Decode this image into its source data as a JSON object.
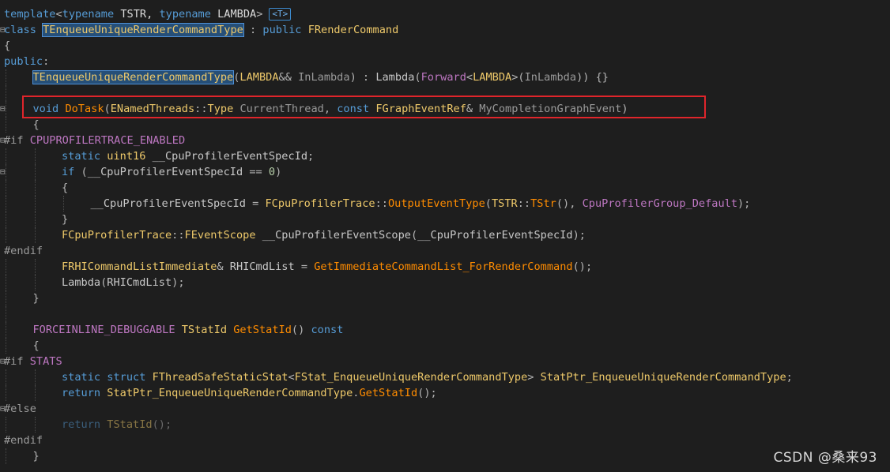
{
  "colors": {
    "background": "#1e1e1e",
    "keyword": "#569cd6",
    "type": "#4ec9b0",
    "function": "#ff8c00",
    "macro": "#be77c2",
    "highlight_box": "#e0252b"
  },
  "template_badge": "<T>",
  "watermark": "CSDN @桑来93",
  "lines": [
    {
      "indent": 0,
      "tokens": [
        {
          "t": "template",
          "c": "kw"
        },
        {
          "t": "<",
          "c": "punct"
        },
        {
          "t": "typename",
          "c": "kw"
        },
        {
          "t": " TSTR, ",
          "c": "plain"
        },
        {
          "t": "typename",
          "c": "kw"
        },
        {
          "t": " LAMBDA",
          "c": "plain"
        },
        {
          "t": ">",
          "c": "punct"
        }
      ],
      "badge": true
    },
    {
      "indent": 0,
      "fold": true,
      "tokens": [
        {
          "t": "class",
          "c": "kw"
        },
        {
          "t": " ",
          "c": "plain"
        },
        {
          "t": "TEnqueueUniqueRenderCommandType",
          "c": "ftype",
          "sel": true
        },
        {
          "t": " : ",
          "c": "punct"
        },
        {
          "t": "public",
          "c": "kw"
        },
        {
          "t": " ",
          "c": "plain"
        },
        {
          "t": "FRenderCommand",
          "c": "ftype"
        }
      ]
    },
    {
      "indent": 0,
      "tokens": [
        {
          "t": "{",
          "c": "punct"
        }
      ]
    },
    {
      "indent": 0,
      "tokens": [
        {
          "t": "public",
          "c": "kw"
        },
        {
          "t": ":",
          "c": "punct"
        }
      ]
    },
    {
      "indent": 1,
      "tokens": [
        {
          "t": "TEnqueueUniqueRenderCommandType",
          "c": "ftype",
          "sel": true
        },
        {
          "t": "(",
          "c": "punct"
        },
        {
          "t": "LAMBDA",
          "c": "ftype"
        },
        {
          "t": "&& ",
          "c": "punct"
        },
        {
          "t": "InLambda",
          "c": "param"
        },
        {
          "t": ") : ",
          "c": "punct"
        },
        {
          "t": "Lambda",
          "c": "var"
        },
        {
          "t": "(",
          "c": "punct"
        },
        {
          "t": "Forward",
          "c": "macro"
        },
        {
          "t": "<",
          "c": "punct"
        },
        {
          "t": "LAMBDA",
          "c": "ftype"
        },
        {
          "t": ">(",
          "c": "punct"
        },
        {
          "t": "InLambda",
          "c": "param"
        },
        {
          "t": ")) {}",
          "c": "punct"
        }
      ]
    },
    {
      "indent": 1,
      "tokens": []
    },
    {
      "indent": 1,
      "fold": true,
      "tokens": [
        {
          "t": "void",
          "c": "kw"
        },
        {
          "t": " ",
          "c": "plain"
        },
        {
          "t": "DoTask",
          "c": "fn"
        },
        {
          "t": "(",
          "c": "punct"
        },
        {
          "t": "ENamedThreads",
          "c": "ftype"
        },
        {
          "t": "::",
          "c": "punct"
        },
        {
          "t": "Type",
          "c": "ftype"
        },
        {
          "t": " ",
          "c": "plain"
        },
        {
          "t": "CurrentThread",
          "c": "param"
        },
        {
          "t": ", ",
          "c": "punct"
        },
        {
          "t": "const",
          "c": "kw"
        },
        {
          "t": " ",
          "c": "plain"
        },
        {
          "t": "FGraphEventRef",
          "c": "ftype"
        },
        {
          "t": "& ",
          "c": "punct"
        },
        {
          "t": "MyCompletionGraphEvent",
          "c": "param"
        },
        {
          "t": ")",
          "c": "punct"
        }
      ]
    },
    {
      "indent": 1,
      "tokens": [
        {
          "t": "{",
          "c": "punct"
        }
      ]
    },
    {
      "indent": 0,
      "fold": true,
      "tokens": [
        {
          "t": "#if ",
          "c": "pp"
        },
        {
          "t": "CPUPROFILERTRACE_ENABLED",
          "c": "macro"
        }
      ]
    },
    {
      "indent": 2,
      "tokens": [
        {
          "t": "static",
          "c": "kw"
        },
        {
          "t": " ",
          "c": "plain"
        },
        {
          "t": "uint16",
          "c": "ftype"
        },
        {
          "t": " ",
          "c": "plain"
        },
        {
          "t": "__CpuProfilerEventSpecId",
          "c": "var"
        },
        {
          "t": ";",
          "c": "punct"
        }
      ]
    },
    {
      "indent": 2,
      "fold": true,
      "tokens": [
        {
          "t": "if",
          "c": "kw"
        },
        {
          "t": " (",
          "c": "punct"
        },
        {
          "t": "__CpuProfilerEventSpecId",
          "c": "var"
        },
        {
          "t": " == ",
          "c": "punct"
        },
        {
          "t": "0",
          "c": "num"
        },
        {
          "t": ")",
          "c": "punct"
        }
      ]
    },
    {
      "indent": 2,
      "tokens": [
        {
          "t": "{",
          "c": "punct"
        }
      ]
    },
    {
      "indent": 3,
      "tokens": [
        {
          "t": "__CpuProfilerEventSpecId",
          "c": "var"
        },
        {
          "t": " = ",
          "c": "punct"
        },
        {
          "t": "FCpuProfilerTrace",
          "c": "ftype"
        },
        {
          "t": "::",
          "c": "punct"
        },
        {
          "t": "OutputEventType",
          "c": "fn"
        },
        {
          "t": "(",
          "c": "punct"
        },
        {
          "t": "TSTR",
          "c": "ftype"
        },
        {
          "t": "::",
          "c": "punct"
        },
        {
          "t": "TStr",
          "c": "fn"
        },
        {
          "t": "(), ",
          "c": "punct"
        },
        {
          "t": "CpuProfilerGroup_Default",
          "c": "macro"
        },
        {
          "t": ");",
          "c": "punct"
        }
      ]
    },
    {
      "indent": 2,
      "tokens": [
        {
          "t": "}",
          "c": "punct"
        }
      ]
    },
    {
      "indent": 2,
      "tokens": [
        {
          "t": "FCpuProfilerTrace",
          "c": "ftype"
        },
        {
          "t": "::",
          "c": "punct"
        },
        {
          "t": "FEventScope",
          "c": "ftype"
        },
        {
          "t": " ",
          "c": "plain"
        },
        {
          "t": "__CpuProfilerEventScope",
          "c": "var"
        },
        {
          "t": "(",
          "c": "punct"
        },
        {
          "t": "__CpuProfilerEventSpecId",
          "c": "var"
        },
        {
          "t": ");",
          "c": "punct"
        }
      ]
    },
    {
      "indent": 0,
      "tokens": [
        {
          "t": "#endif",
          "c": "pp"
        }
      ]
    },
    {
      "indent": 2,
      "tokens": [
        {
          "t": "FRHICommandListImmediate",
          "c": "ftype"
        },
        {
          "t": "& ",
          "c": "punct"
        },
        {
          "t": "RHICmdList",
          "c": "var"
        },
        {
          "t": " = ",
          "c": "punct"
        },
        {
          "t": "GetImmediateCommandList_ForRenderCommand",
          "c": "fn"
        },
        {
          "t": "();",
          "c": "punct"
        }
      ]
    },
    {
      "indent": 2,
      "tokens": [
        {
          "t": "Lambda",
          "c": "var"
        },
        {
          "t": "(",
          "c": "punct"
        },
        {
          "t": "RHICmdList",
          "c": "var"
        },
        {
          "t": ");",
          "c": "punct"
        }
      ]
    },
    {
      "indent": 1,
      "tokens": [
        {
          "t": "}",
          "c": "punct"
        }
      ]
    },
    {
      "indent": 1,
      "tokens": []
    },
    {
      "indent": 1,
      "tokens": [
        {
          "t": "FORCEINLINE_DEBUGGABLE",
          "c": "macro"
        },
        {
          "t": " ",
          "c": "plain"
        },
        {
          "t": "TStatId",
          "c": "ftype"
        },
        {
          "t": " ",
          "c": "plain"
        },
        {
          "t": "GetStatId",
          "c": "fn"
        },
        {
          "t": "() ",
          "c": "punct"
        },
        {
          "t": "const",
          "c": "kw"
        }
      ]
    },
    {
      "indent": 1,
      "tokens": [
        {
          "t": "{",
          "c": "punct"
        }
      ]
    },
    {
      "indent": 0,
      "fold": true,
      "tokens": [
        {
          "t": "#if ",
          "c": "pp"
        },
        {
          "t": "STATS",
          "c": "macro"
        }
      ]
    },
    {
      "indent": 2,
      "tokens": [
        {
          "t": "static",
          "c": "kw"
        },
        {
          "t": " ",
          "c": "plain"
        },
        {
          "t": "struct",
          "c": "kw"
        },
        {
          "t": " ",
          "c": "plain"
        },
        {
          "t": "FThreadSafeStaticStat",
          "c": "ftype"
        },
        {
          "t": "<",
          "c": "punct"
        },
        {
          "t": "FStat_EnqueueUniqueRenderCommandType",
          "c": "ftype"
        },
        {
          "t": "> ",
          "c": "punct"
        },
        {
          "t": "StatPtr_EnqueueUniqueRenderCommandType",
          "c": "ftype"
        },
        {
          "t": ";",
          "c": "punct"
        }
      ]
    },
    {
      "indent": 2,
      "tokens": [
        {
          "t": "return",
          "c": "kw"
        },
        {
          "t": " ",
          "c": "plain"
        },
        {
          "t": "StatPtr_EnqueueUniqueRenderCommandType",
          "c": "ftype"
        },
        {
          "t": ".",
          "c": "punct"
        },
        {
          "t": "GetStatId",
          "c": "fn"
        },
        {
          "t": "();",
          "c": "punct"
        }
      ]
    },
    {
      "indent": 0,
      "fold": true,
      "tokens": [
        {
          "t": "#else",
          "c": "pp"
        }
      ]
    },
    {
      "indent": 2,
      "dim": true,
      "tokens": [
        {
          "t": "return",
          "c": "kw"
        },
        {
          "t": " ",
          "c": "plain"
        },
        {
          "t": "TStatId",
          "c": "ftype"
        },
        {
          "t": "();",
          "c": "punct"
        }
      ]
    },
    {
      "indent": 0,
      "tokens": [
        {
          "t": "#endif",
          "c": "pp"
        }
      ]
    },
    {
      "indent": 1,
      "tokens": [
        {
          "t": "}",
          "c": "punct"
        }
      ]
    }
  ]
}
